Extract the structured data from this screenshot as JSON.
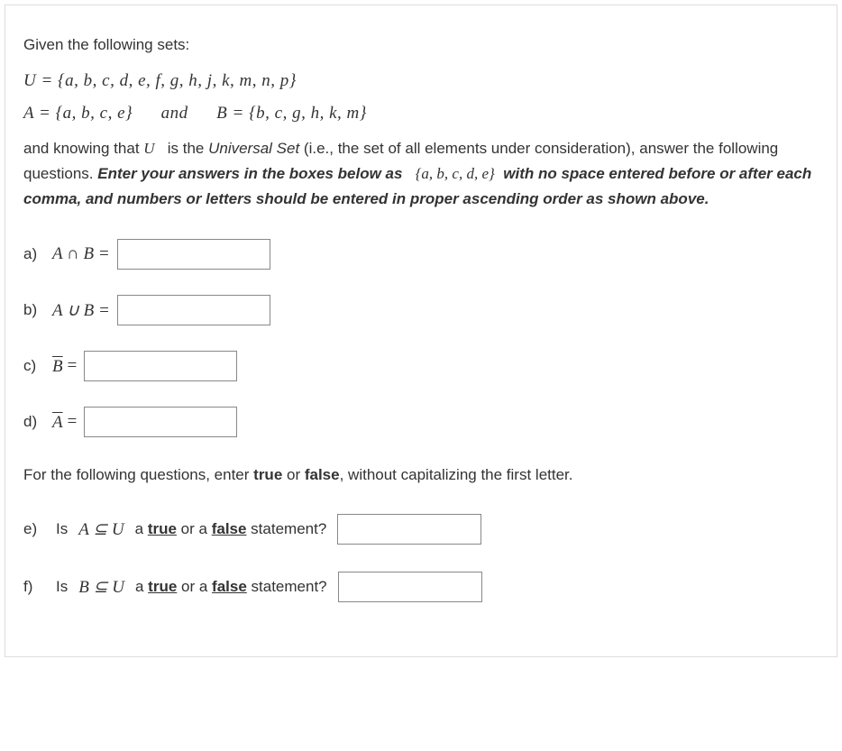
{
  "intro": "Given the following sets:",
  "set_U": "U = {a, b, c, d, e, f, g, h, j, k, m, n, p}",
  "set_A": "A = {a, b, c, e}",
  "and_word": "and",
  "set_B": "B = {b, c, g, h, k, m}",
  "instr_part1": "and knowing that ",
  "instr_U": "U",
  "instr_part2": " is the ",
  "instr_universal": "Universal Set",
  "instr_part3": " (i.e., the set of all elements under consideration), answer the following questions. ",
  "instr_bold1": "Enter your answers in the boxes below as",
  "instr_example": "{a, b, c, d, e}",
  "instr_bold2": "with no space entered before or after each comma, and numbers or letters should be entered in proper ascending order as shown above.",
  "questions": {
    "a": {
      "label": "a)",
      "expr": "A ∩ B ="
    },
    "b": {
      "label": "b)",
      "expr": "A ∪ B ="
    },
    "c": {
      "label": "c)",
      "var": "B",
      "eq": "="
    },
    "d": {
      "label": "d)",
      "var": "A",
      "eq": "="
    }
  },
  "sub_instr_p1": "For the following questions, enter ",
  "sub_instr_true": "true",
  "sub_instr_or": " or ",
  "sub_instr_false": "false",
  "sub_instr_p2": ", without capitalizing the first letter.",
  "tf": {
    "e": {
      "label": "e)",
      "is": "Is",
      "expr": "A ⊆ U",
      "q_a": "a ",
      "q_true": "true",
      "q_or": " or a ",
      "q_false": "false",
      "q_end": " statement?"
    },
    "f": {
      "label": "f)",
      "is": "Is",
      "expr": "B ⊆ U",
      "q_a": "a ",
      "q_true": "true",
      "q_or": " or a ",
      "q_false": "false",
      "q_end": " statement?"
    }
  }
}
